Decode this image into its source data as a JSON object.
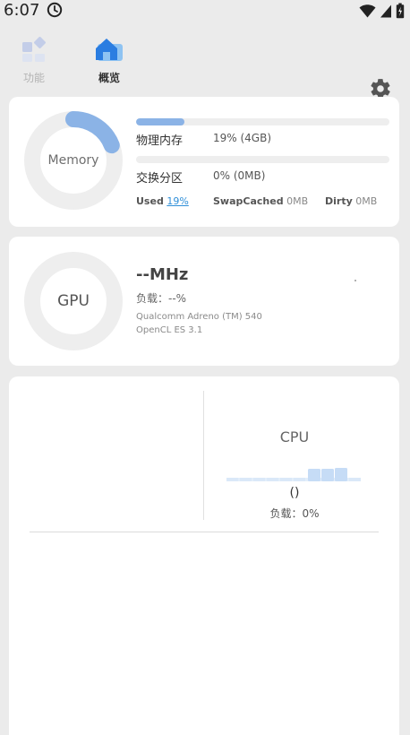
{
  "status_bar": {
    "time": "6:07"
  },
  "tabs": [
    {
      "label": "功能",
      "icon": "grid-icon",
      "active": false
    },
    {
      "label": "概览",
      "icon": "home-icon",
      "active": true
    }
  ],
  "memory": {
    "ring_label": "Memory",
    "ring_fraction": 0.19,
    "physical": {
      "label": "物理内存",
      "value": "19% (4GB)",
      "fraction": 0.19
    },
    "swap": {
      "label": "交换分区",
      "value": "0% (0MB)",
      "fraction": 0.0
    },
    "stats": {
      "used_label": "Used",
      "used_value": "19%",
      "swapcached_label": "SwapCached",
      "swapcached_value": "0MB",
      "dirty_label": "Dirty",
      "dirty_value": "0MB"
    }
  },
  "gpu": {
    "ring_label": "GPU",
    "frequency": "--MHz",
    "load": "负载：--%",
    "name": "Qualcomm Adreno (TM) 540",
    "opencl": "OpenCL ES 3.1"
  },
  "cpu": {
    "title": "CPU",
    "frequency": "()",
    "load": "负载：0%"
  },
  "colors": {
    "accent": "#8bb3e6",
    "ring_track": "#eeeeee",
    "link_blue": "#2f8fd8",
    "active_tab_icon": "#2a7de1"
  }
}
